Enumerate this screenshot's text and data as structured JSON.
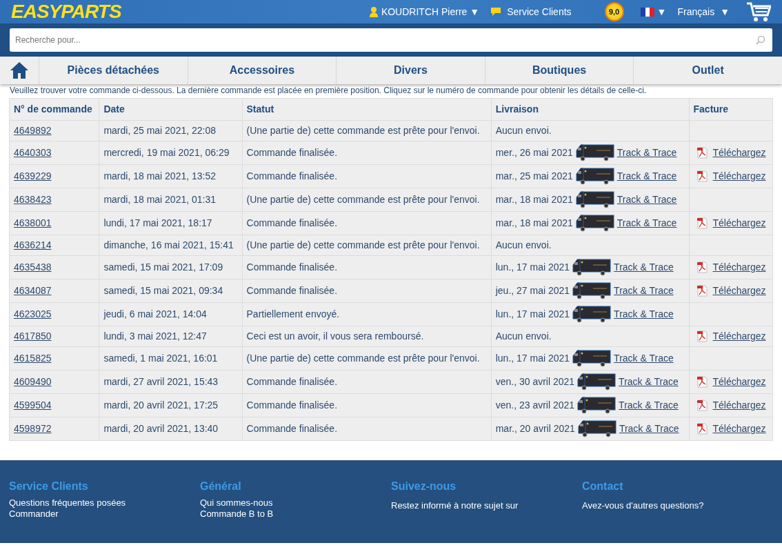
{
  "header": {
    "logo": "EASYPARTS",
    "user": "KOUDRITCH Pierre",
    "user_caret": "▼",
    "service": "Service Clients",
    "rating": "9,0",
    "flag_caret": "▼",
    "language": "Français",
    "language_caret": "▼"
  },
  "search": {
    "placeholder": "Recherche pour..."
  },
  "nav": [
    "Pièces détachées",
    "Accessoires",
    "Divers",
    "Boutiques",
    "Outlet"
  ],
  "intro": "Veuillez trouver votre commande ci-dessous. La dernière commande est placée en première position. Cliquez sur le numéro de commande pour obtenir les détails de celle-ci.",
  "table": {
    "columns": [
      "N° de commande",
      "Date",
      "Statut",
      "Livraison",
      "Facture"
    ],
    "rows": [
      {
        "number": "4649892",
        "date": "mardi, 25 mai 2021, 22:08",
        "status": "(Une partie de) cette commande est prête pour l'envoi.",
        "delivery": "Aucun envoi."
      },
      {
        "number": "4640303",
        "date": "mercredi, 19 mai 2021, 06:29",
        "status": "Commande finalisée.",
        "delivery": "mer., 26 mai 2021",
        "tracking": "Track & Trace",
        "invoice": "Téléchargez"
      },
      {
        "number": "4639229",
        "date": "mardi, 18 mai 2021, 13:52",
        "status": "Commande finalisée.",
        "delivery": "mar., 25 mai 2021",
        "tracking": "Track & Trace",
        "invoice": "Téléchargez"
      },
      {
        "number": "4638423",
        "date": "mardi, 18 mai 2021, 01:31",
        "status": "(Une partie de) cette commande est prête pour l'envoi.",
        "delivery": "mar., 18 mai 2021",
        "tracking": "Track & Trace"
      },
      {
        "number": "4638001",
        "date": "lundi, 17 mai 2021, 18:17",
        "status": "Commande finalisée.",
        "delivery": "mar., 18 mai 2021",
        "tracking": "Track & Trace",
        "invoice": "Téléchargez"
      },
      {
        "number": "4636214",
        "date": "dimanche, 16 mai 2021, 15:41",
        "status": "(Une partie de) cette commande est prête pour l'envoi.",
        "delivery": "Aucun envoi."
      },
      {
        "number": "4635438",
        "date": "samedi, 15 mai 2021, 17:09",
        "status": "Commande finalisée.",
        "delivery": "lun., 17 mai 2021",
        "tracking": "Track & Trace",
        "invoice": "Téléchargez"
      },
      {
        "number": "4634087",
        "date": "samedi, 15 mai 2021, 09:34",
        "status": "Commande finalisée.",
        "delivery": "jeu., 27 mai 2021",
        "tracking": "Track & Trace",
        "invoice": "Téléchargez"
      },
      {
        "number": "4623025",
        "date": "jeudi, 6 mai 2021, 14:04",
        "status": "Partiellement envoyé.",
        "delivery": "lun., 17 mai 2021",
        "tracking": "Track & Trace"
      },
      {
        "number": "4617850",
        "date": "lundi, 3 mai 2021, 12:47",
        "status": "Ceci est un avoir, il vous sera remboursé.",
        "delivery": "Aucun envoi.",
        "invoice": "Téléchargez"
      },
      {
        "number": "4615825",
        "date": "samedi, 1 mai 2021, 16:01",
        "status": "(Une partie de) cette commande est prête pour l'envoi.",
        "delivery": "lun., 17 mai 2021",
        "tracking": "Track & Trace"
      },
      {
        "number": "4609490",
        "date": "mardi, 27 avril 2021, 15:43",
        "status": "Commande finalisée.",
        "delivery": "ven., 30 avril 2021",
        "tracking": "Track & Trace",
        "invoice": "Téléchargez"
      },
      {
        "number": "4599504",
        "date": "mardi, 20 avril 2021, 17:25",
        "status": "Commande finalisée.",
        "delivery": "ven., 23 avril 2021",
        "tracking": "Track & Trace",
        "invoice": "Téléchargez"
      },
      {
        "number": "4598972",
        "date": "mardi, 20 avril 2021, 13:40",
        "status": "Commande finalisée.",
        "delivery": "mar., 20 avril 2021",
        "tracking": "Track & Trace",
        "invoice": "Téléchargez"
      }
    ]
  },
  "footer": [
    {
      "title": "Service Clients",
      "links": [
        "Questions fréquentes posées",
        "Commander"
      ]
    },
    {
      "title": "Général",
      "links": [
        "Qui sommes-nous",
        "Commande B to B"
      ]
    },
    {
      "title": "Suivez-nous",
      "text": "Restez informé à notre sujet sur"
    },
    {
      "title": "Contact",
      "text": "Avez-vous d'autres questions?"
    }
  ]
}
